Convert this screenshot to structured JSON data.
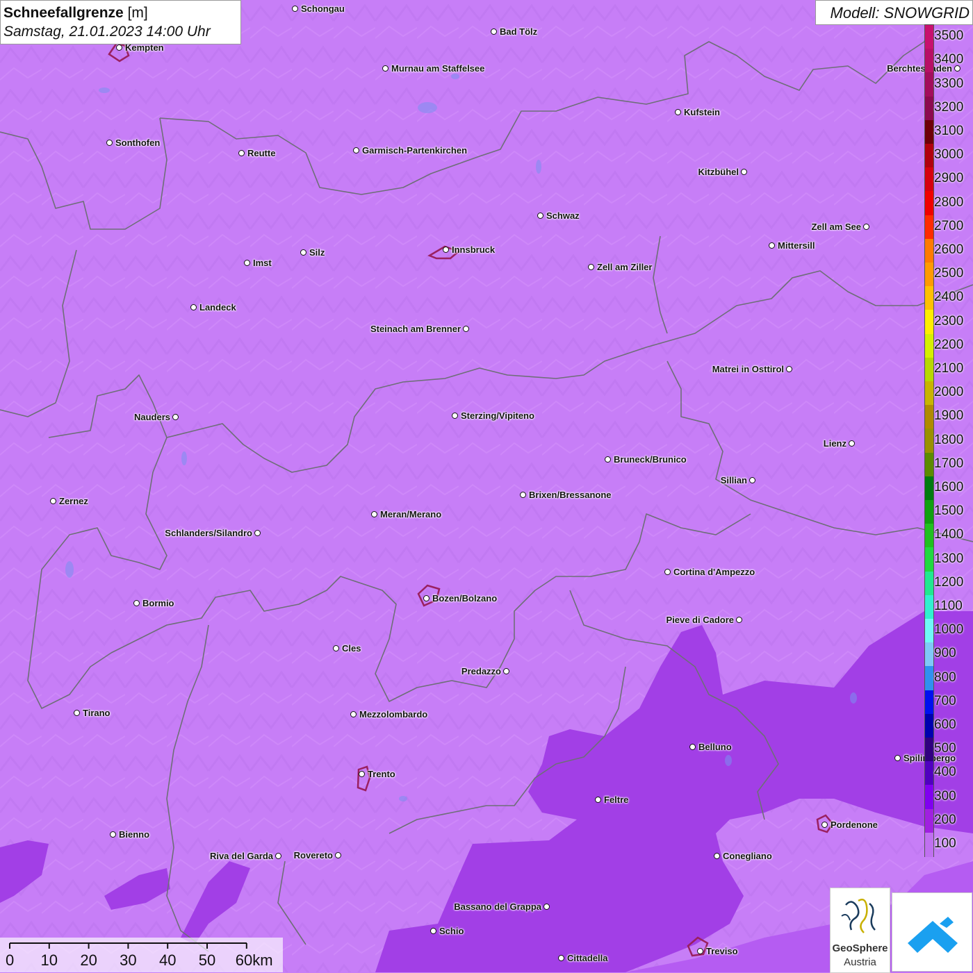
{
  "title": {
    "main_bold": "Schneefallgrenze",
    "main_unit": " [m]",
    "datetime": "Samstag, 21.01.2023 14:00 Uhr"
  },
  "model_label": "Modell: SNOWGRID",
  "colors": {
    "base_fill": "#c77ef7",
    "fill_200": "#a23fe6",
    "fill_300": "#b55cf2",
    "border_line": "#6e6e78",
    "city_outline": "#9a2060"
  },
  "legend": {
    "values": [
      3500,
      3400,
      3300,
      3200,
      3100,
      3000,
      2900,
      2800,
      2700,
      2600,
      2500,
      2400,
      2300,
      2200,
      2100,
      2000,
      1900,
      1800,
      1700,
      1600,
      1500,
      1400,
      1300,
      1200,
      1100,
      1000,
      900,
      800,
      700,
      600,
      500,
      400,
      300,
      200,
      100
    ],
    "colors": [
      "#c8106e",
      "#b80f66",
      "#a30d5c",
      "#8c0a4f",
      "#6e0008",
      "#b1000e",
      "#d6000f",
      "#f00000",
      "#ff2a00",
      "#ff7a00",
      "#ff9a00",
      "#ffc000",
      "#ffee00",
      "#d6f000",
      "#b8d800",
      "#c8b400",
      "#b08a00",
      "#9a9000",
      "#5c8a00",
      "#007a10",
      "#10a010",
      "#20c020",
      "#20d840",
      "#20e890",
      "#30f0d0",
      "#70f8f8",
      "#80c8f8",
      "#3090f0",
      "#0010f0",
      "#0000b0",
      "#300080",
      "#5000c0",
      "#8000f0",
      "#a020e0",
      "#c070f0"
    ]
  },
  "cities": [
    {
      "name": "Schongau",
      "label_side": "right"
    },
    {
      "name": "Bad Tölz",
      "label_side": "right"
    },
    {
      "name": "Kempten",
      "label_side": "right"
    },
    {
      "name": "Murnau am Staffelsee",
      "label_side": "right"
    },
    {
      "name": "Berchtesgaden",
      "label_side": "left"
    },
    {
      "name": "Kufstein",
      "label_side": "right"
    },
    {
      "name": "Sonthofen",
      "label_side": "right"
    },
    {
      "name": "Reutte",
      "label_side": "right"
    },
    {
      "name": "Garmisch-Partenkirchen",
      "label_side": "right"
    },
    {
      "name": "Kitzbühel",
      "label_side": "left"
    },
    {
      "name": "Schwaz",
      "label_side": "right"
    },
    {
      "name": "Zell am See",
      "label_side": "left"
    },
    {
      "name": "Mittersill",
      "label_side": "right"
    },
    {
      "name": "Innsbruck",
      "label_side": "right"
    },
    {
      "name": "Imst",
      "label_side": "right"
    },
    {
      "name": "Silz",
      "label_side": "right"
    },
    {
      "name": "Zell am Ziller",
      "label_side": "right"
    },
    {
      "name": "Landeck",
      "label_side": "right"
    },
    {
      "name": "Steinach am Brenner",
      "label_side": "left"
    },
    {
      "name": "Matrei in Osttirol",
      "label_side": "left"
    },
    {
      "name": "Nauders",
      "label_side": "left"
    },
    {
      "name": "Sterzing/Vipiteno",
      "label_side": "right"
    },
    {
      "name": "Lienz",
      "label_side": "left"
    },
    {
      "name": "Bruneck/Brunico",
      "label_side": "right"
    },
    {
      "name": "Sillian",
      "label_side": "left"
    },
    {
      "name": "Brixen/Bressanone",
      "label_side": "right"
    },
    {
      "name": "Zernez",
      "label_side": "right"
    },
    {
      "name": "Meran/Merano",
      "label_side": "right"
    },
    {
      "name": "Schlanders/Silandro",
      "label_side": "left"
    },
    {
      "name": "Cortina d'Ampezzo",
      "label_side": "right"
    },
    {
      "name": "Bormio",
      "label_side": "right"
    },
    {
      "name": "Bozen/Bolzano",
      "label_side": "right"
    },
    {
      "name": "Pieve di Cadore",
      "label_side": "left"
    },
    {
      "name": "Cles",
      "label_side": "right"
    },
    {
      "name": "Predazzo",
      "label_side": "left"
    },
    {
      "name": "Tirano",
      "label_side": "right"
    },
    {
      "name": "Mezzolombardo",
      "label_side": "right"
    },
    {
      "name": "Belluno",
      "label_side": "right"
    },
    {
      "name": "Spilimbergo",
      "label_side": "right"
    },
    {
      "name": "Trento",
      "label_side": "right"
    },
    {
      "name": "Feltre",
      "label_side": "right"
    },
    {
      "name": "Pordenone",
      "label_side": "right"
    },
    {
      "name": "Bienno",
      "label_side": "right"
    },
    {
      "name": "Riva del Garda",
      "label_side": "left"
    },
    {
      "name": "Rovereto",
      "label_side": "left"
    },
    {
      "name": "Conegliano",
      "label_side": "right"
    },
    {
      "name": "Bassano del Grappa",
      "label_side": "left"
    },
    {
      "name": "Schio",
      "label_side": "right"
    },
    {
      "name": "Treviso",
      "label_side": "right"
    },
    {
      "name": "Cittadella",
      "label_side": "right"
    }
  ],
  "scalebar": {
    "labels": [
      "0",
      "10",
      "20",
      "30",
      "40",
      "50",
      "60km"
    ]
  },
  "logos": {
    "geosphere_name": "GeoSphere",
    "geosphere_sub": "Austria"
  }
}
